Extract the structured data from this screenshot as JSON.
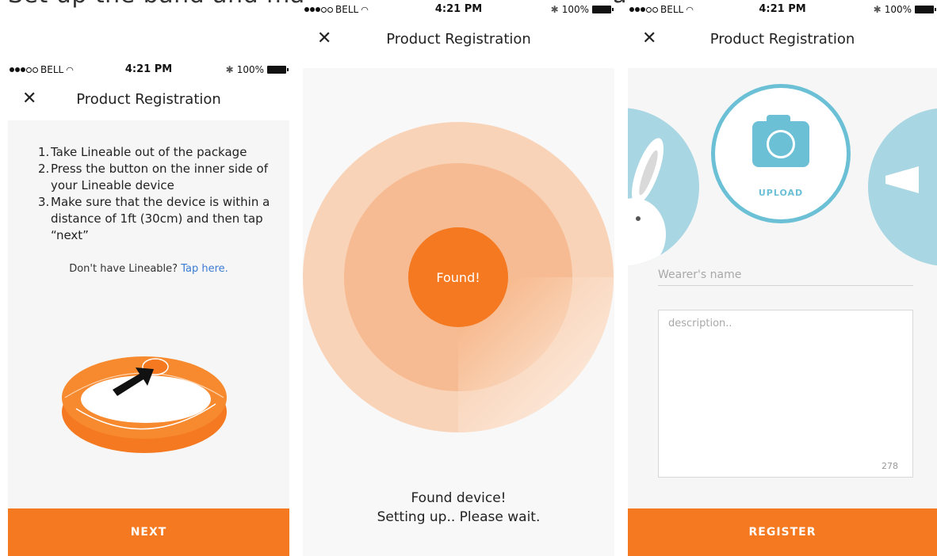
{
  "caption": "Set up the band and make sure that the device has been located",
  "status_bar": {
    "carrier": "BELL",
    "time": "4:21 PM",
    "battery": "100%"
  },
  "screen1": {
    "title": "Product Registration",
    "steps": [
      {
        "num": "1.",
        "text": "Take Lineable out of the package"
      },
      {
        "num": "2.",
        "text": "Press the button on the inner side of your Lineable device"
      },
      {
        "num": "3.",
        "text": "Make sure that the device is within a distance of 1ft (30cm) and then tap “next”"
      }
    ],
    "prompt": "Don't have Lineable?",
    "link": "Tap here.",
    "button": "NEXT"
  },
  "screen2": {
    "title": "Product Registration",
    "badge": "Found!",
    "message_line1": "Found device!",
    "message_line2": "Setting up.. Please wait."
  },
  "screen3": {
    "title": "Product Registration",
    "upload_label": "UPLOAD",
    "name_placeholder": "Wearer's name",
    "description_placeholder": "description..",
    "char_count": "278",
    "button": "REGISTER"
  },
  "colors": {
    "accent": "#f47920",
    "teal": "#6bc0d6",
    "light_blue": "#a9d6e3",
    "link": "#3b7bd4"
  }
}
